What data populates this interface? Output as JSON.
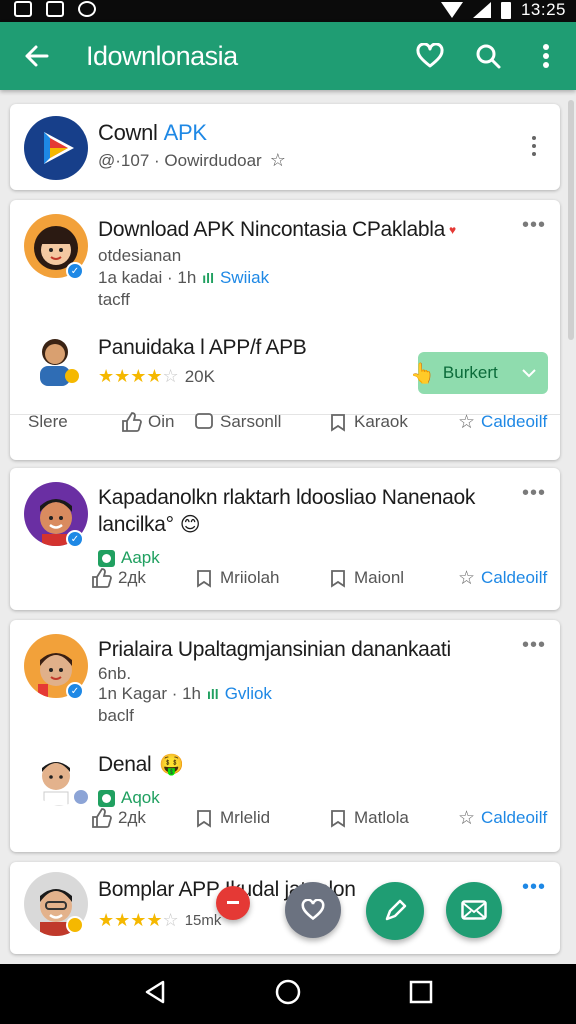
{
  "status_bar": {
    "time": "13:25"
  },
  "app_bar": {
    "title": "Idownlonasia"
  },
  "header_card": {
    "title_a": "Cownl",
    "title_b": "APK",
    "subtitle": "@·107 · Oowirdudoar"
  },
  "posts": [
    {
      "title": "Download APK Nincontasia CPaklabla",
      "line1": "otdesianan",
      "meta_a": "1a kadai · 1h",
      "meta_b": "Swiiak",
      "line3": "tacff",
      "sub_item_title": "Panuidaka l APP/f APB",
      "rating_count": "20K",
      "button_label": "Burkert",
      "actions": [
        "Slere",
        "Oin",
        "Sarsonll",
        "Karaok",
        "Caldeoilf"
      ]
    },
    {
      "title_line1": "Kapadanolkn rlaktarh ldoosliao Nanenaok",
      "title_line2": "lancilka°",
      "emoji": "😊",
      "apk_label": "Aapk",
      "actions": [
        "2дk",
        "Mriiolah",
        "Maionl",
        "Caldeoilf"
      ]
    },
    {
      "title": "Prialaira Upaltagmjansinian danankaati",
      "line1": "6nb.",
      "meta_a": "1n Kagar · 1h",
      "meta_b": "Gvliok",
      "line3": "baclf",
      "sub_item_title": "Denal",
      "emoji": "🤑",
      "apk_label": "Aqok",
      "actions": [
        "2дk",
        "Mrlelid",
        "Matlola",
        "Caldeoilf"
      ]
    },
    {
      "title": "Bomplar APP Ikudal jatanlon",
      "rating_count": "15mk"
    }
  ],
  "colors": {
    "brand_green": "#1f9d73",
    "accent_blue": "#1e88e5",
    "star": "#f5b800"
  }
}
